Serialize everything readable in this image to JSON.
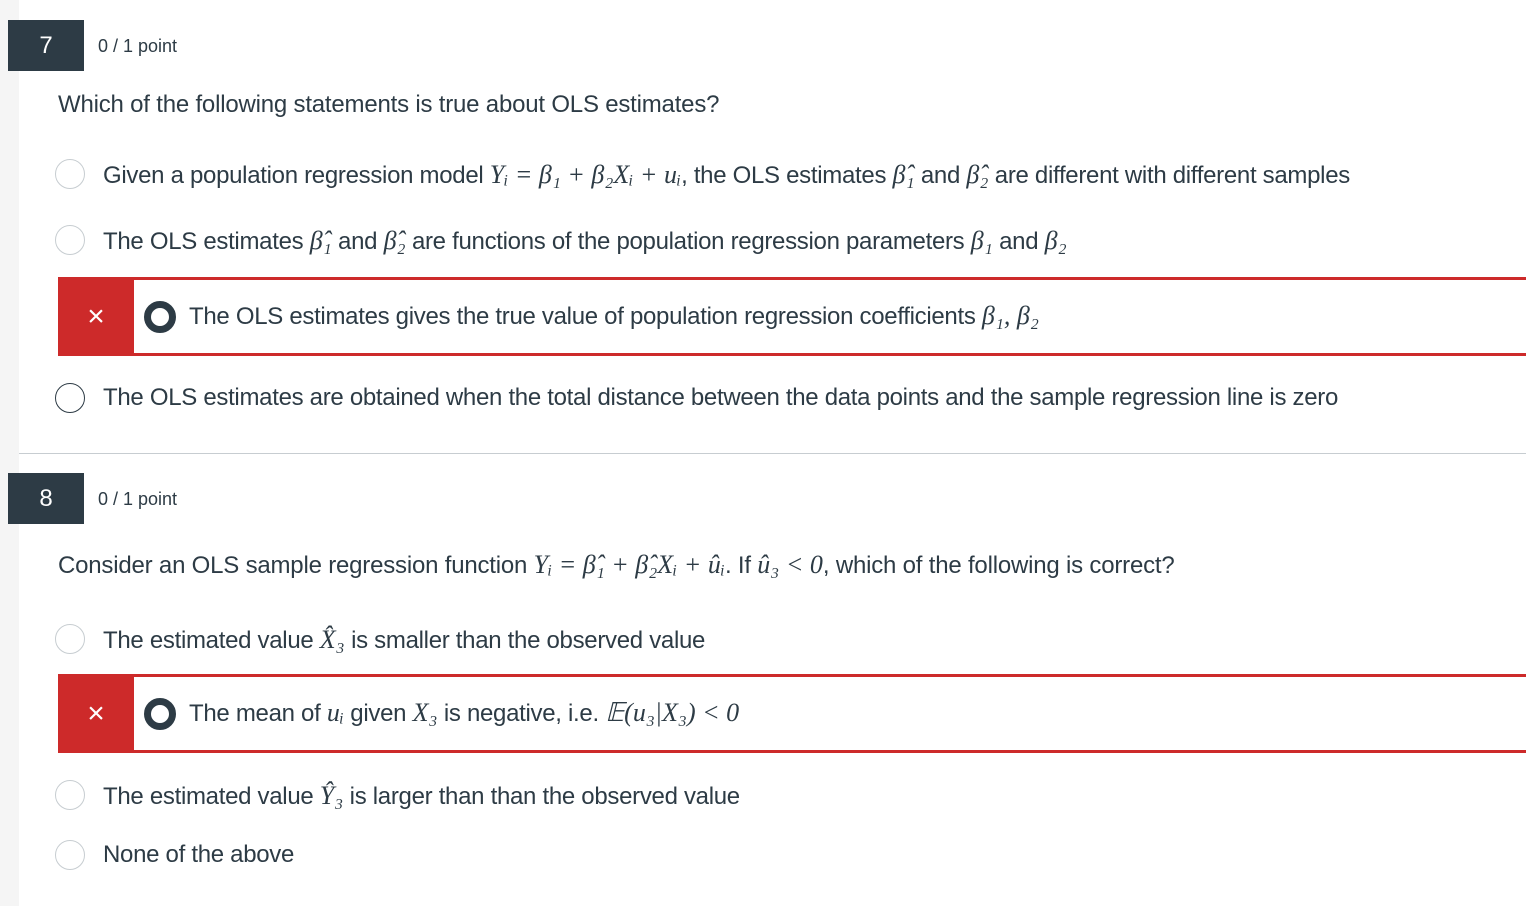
{
  "q7": {
    "number": "7",
    "points": "0 / 1 point",
    "prompt": "Which of the following statements is true about OLS estimates?",
    "options": {
      "a_pre": "Given a population regression model ",
      "a_math": "Yᵢ = β₁ + β₂Xᵢ + uᵢ",
      "a_mid": ", the OLS estimates ",
      "a_b1": "β̂₁",
      "a_and": " and ",
      "a_b2": "β̂₂",
      "a_post": " are different with different samples",
      "b_pre": "The OLS estimates ",
      "b_b1": "β̂₁",
      "b_and": " and ",
      "b_b2": "β̂₂",
      "b_mid": " are functions of the population regression parameters ",
      "b_p1": "β₁",
      "b_and2": " and ",
      "b_p2": "β₂",
      "c_pre": "The OLS estimates gives the true value of population regression coefficients ",
      "c_math": "β₁,  β₂",
      "d_text": "The OLS estimates are obtained when the total distance between the data points and the sample regression line is zero"
    },
    "wrong_mark": "×"
  },
  "q8": {
    "number": "8",
    "points": "0 / 1 point",
    "prompt_pre": "Consider an OLS sample regression function ",
    "prompt_math": "Yᵢ = β̂₁ + β̂₂Xᵢ + ûᵢ",
    "prompt_mid": ". If ",
    "prompt_math2": "û₃ < 0",
    "prompt_post": ", which of the following is correct?",
    "options": {
      "a_pre": "The estimated value ",
      "a_math": "X̂₃",
      "a_post": " is smaller than the observed value",
      "b_pre": "The mean of ",
      "b_m1": "uᵢ",
      "b_mid": " given ",
      "b_m2": "X₃",
      "b_mid2": " is negative, i.e. ",
      "b_m3": "𝔼(u₃|X₃) < 0",
      "c_pre": "The estimated value ",
      "c_math": "Ŷ₃",
      "c_post": " is larger than than the observed value",
      "d_text": "None of the above"
    },
    "wrong_mark": "×"
  }
}
